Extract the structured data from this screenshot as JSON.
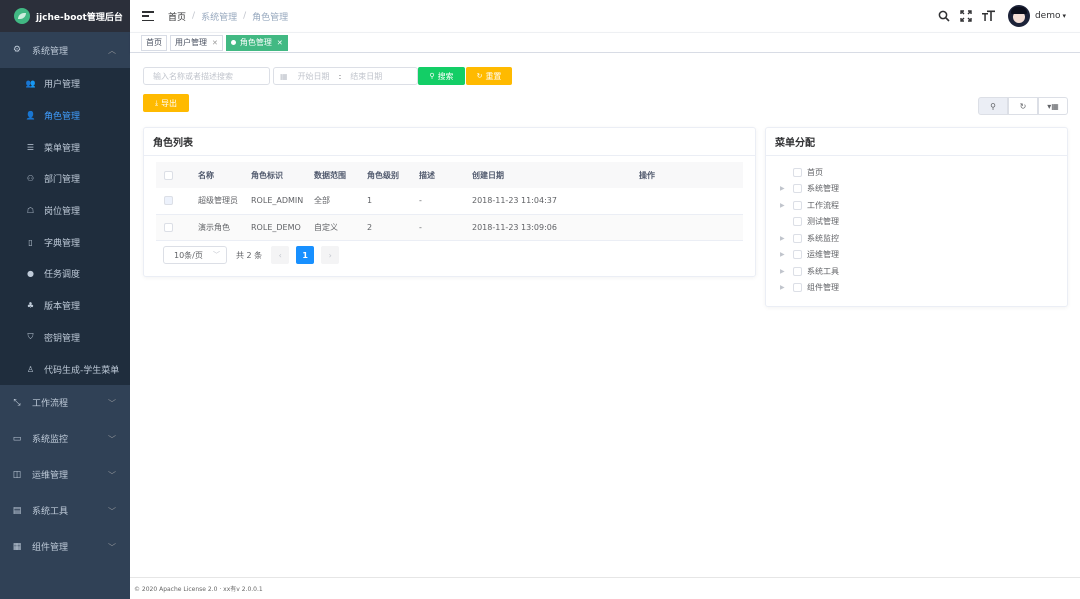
{
  "app": {
    "title": "jjche-boot管理后台"
  },
  "sidebar": {
    "groups": [
      {
        "label": "系统管理",
        "icon": "gear-icon",
        "expanded": true
      },
      {
        "label": "工作流程",
        "icon": "workflow-icon"
      },
      {
        "label": "系统监控",
        "icon": "monitor-icon"
      },
      {
        "label": "运维管理",
        "icon": "ops-icon"
      },
      {
        "label": "系统工具",
        "icon": "tools-icon"
      },
      {
        "label": "组件管理",
        "icon": "components-icon"
      }
    ],
    "items": [
      {
        "label": "用户管理",
        "icon": "users-icon"
      },
      {
        "label": "角色管理",
        "icon": "role-icon",
        "active": true
      },
      {
        "label": "菜单管理",
        "icon": "menu-list-icon"
      },
      {
        "label": "部门管理",
        "icon": "dept-icon"
      },
      {
        "label": "岗位管理",
        "icon": "post-icon"
      },
      {
        "label": "字典管理",
        "icon": "dict-icon"
      },
      {
        "label": "任务调度",
        "icon": "timer-icon"
      },
      {
        "label": "版本管理",
        "icon": "version-icon"
      },
      {
        "label": "密钥管理",
        "icon": "key-icon"
      },
      {
        "label": "代码生成-学生菜单",
        "icon": "codegen-icon"
      }
    ]
  },
  "navbar": {
    "breadcrumb": [
      "首页",
      "系统管理",
      "角色管理"
    ],
    "user": "demo"
  },
  "tags": [
    {
      "label": "首页"
    },
    {
      "label": "用户管理"
    },
    {
      "label": "角色管理",
      "active": true
    }
  ],
  "toolbar": {
    "search_placeholder": "输入名称或者描述搜索",
    "start_placeholder": "开始日期",
    "end_placeholder": "结束日期",
    "range_separator": ":",
    "search_label": "搜索",
    "reset_label": "重置",
    "export_label": "导出"
  },
  "role_list": {
    "title": "角色列表",
    "columns": [
      "名称",
      "角色标识",
      "数据范围",
      "角色级别",
      "描述",
      "创建日期",
      "操作"
    ],
    "rows": [
      {
        "name": "超级管理员",
        "code": "ROLE_ADMIN",
        "scope": "全部",
        "level": "1",
        "desc": "-",
        "created": "2018-11-23 11:04:37"
      },
      {
        "name": "演示角色",
        "code": "ROLE_DEMO",
        "scope": "自定义",
        "level": "2",
        "desc": "-",
        "created": "2018-11-23 13:09:06"
      }
    ],
    "pagination": {
      "page_size": "10条/页",
      "total": "共 2 条",
      "current_page": "1"
    }
  },
  "menu_assign": {
    "title": "菜单分配",
    "nodes": [
      {
        "label": "首页",
        "expandable": false
      },
      {
        "label": "系统管理",
        "expandable": true
      },
      {
        "label": "工作流程",
        "expandable": true
      },
      {
        "label": "测试管理",
        "expandable": false
      },
      {
        "label": "系统监控",
        "expandable": true
      },
      {
        "label": "运维管理",
        "expandable": true
      },
      {
        "label": "系统工具",
        "expandable": true
      },
      {
        "label": "组件管理",
        "expandable": true
      }
    ]
  },
  "footer": {
    "text": "© 2020 Apache License 2.0 · xx有v 2.0.0.1"
  },
  "colors": {
    "sidebar_bg": "#304156",
    "active": "#409eff",
    "success": "#13ce66",
    "warning": "#ffba00",
    "tag_active": "#42b983"
  }
}
